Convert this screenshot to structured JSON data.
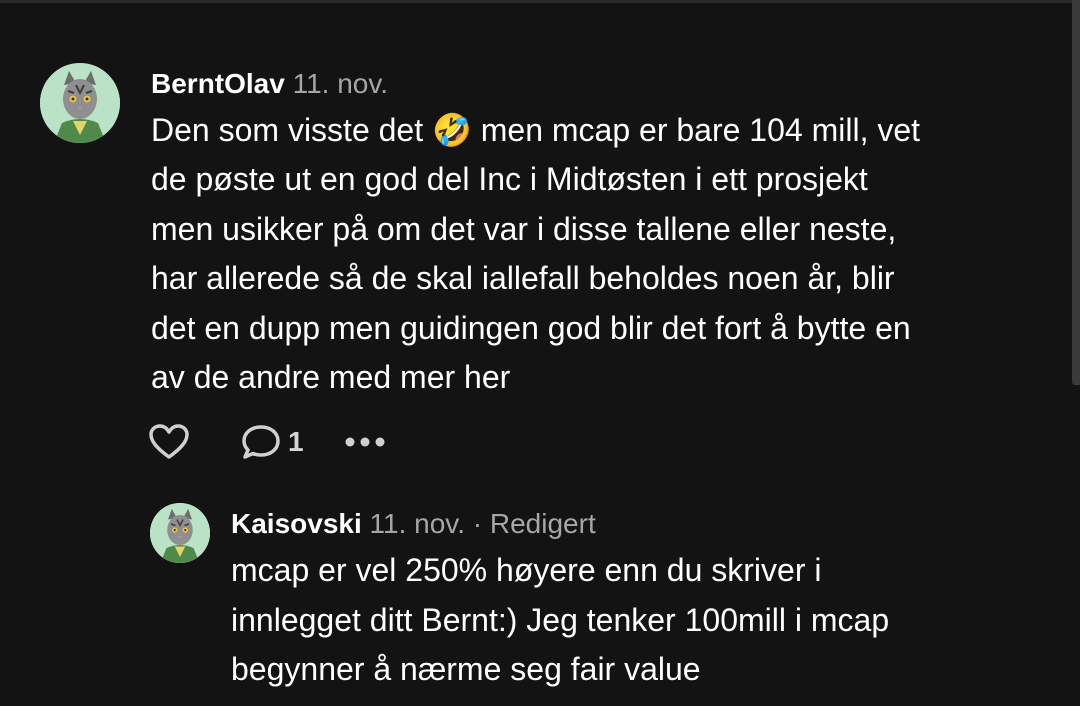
{
  "comments": [
    {
      "author": "BerntOlav",
      "date": "11. nov.",
      "avatar_icon": "cat-avatar-icon",
      "body_lines": [
        "Den som visste det 🤣 men mcap er bare 104 mill,  vet",
        "de pøste ut en god del Inc i Midtøsten i ett prosjekt",
        "men usikker på om det var i disse tallene eller neste,",
        "har allerede så de skal iallefall beholdes noen år, blir",
        "det en dupp men guidingen god blir det fort å bytte en",
        "av de andre med mer her"
      ],
      "actions": {
        "like_icon": "heart-icon",
        "reply_icon": "comment-bubble-icon",
        "reply_count": "1",
        "more_icon": "more-dots-icon"
      }
    },
    {
      "author": "Kaisovski",
      "date": "11. nov. · Redigert",
      "avatar_icon": "cat-avatar-icon",
      "body_lines": [
        "mcap er vel 250% høyere enn du skriver i",
        "innlegget ditt Bernt:) Jeg tenker 100mill i mcap",
        "begynner å nærme seg fair value"
      ]
    }
  ],
  "colors": {
    "background": "#131313",
    "text": "#ffffff",
    "muted": "#a6a6a6",
    "avatar_bg": "#b9e2c6"
  }
}
